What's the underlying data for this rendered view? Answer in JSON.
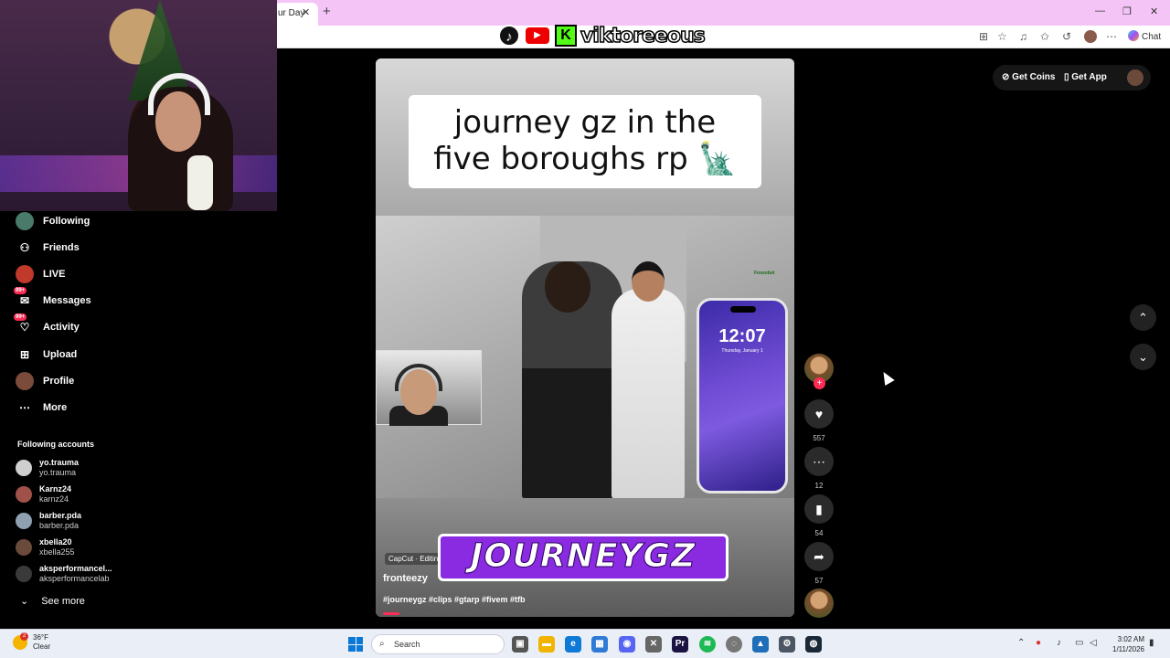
{
  "browser": {
    "tab_title": "ur Day",
    "tab_close": "✕",
    "new_tab": "+",
    "chat_label": "Chat",
    "minimize": "—",
    "maximize": "❐",
    "close": "✕"
  },
  "overlay": {
    "tiktok_glyph": "♪",
    "youtube_glyph": "▶",
    "kick_glyph": "K",
    "streamer_name": "viktoreeous"
  },
  "sidebar": {
    "items": [
      {
        "label": "Following",
        "icon": "following-avatar"
      },
      {
        "label": "Friends",
        "icon": "friends-icon"
      },
      {
        "label": "LIVE",
        "icon": "live-avatar"
      },
      {
        "label": "Messages",
        "icon": "messages-icon",
        "badge": "99+"
      },
      {
        "label": "Activity",
        "icon": "activity-icon",
        "badge": "99+"
      },
      {
        "label": "Upload",
        "icon": "upload-icon"
      },
      {
        "label": "Profile",
        "icon": "profile-avatar"
      },
      {
        "label": "More",
        "icon": "more-icon"
      }
    ],
    "following_title": "Following accounts",
    "accounts": [
      {
        "name": "yo.trauma",
        "handle": "yo.trauma"
      },
      {
        "name": "Karnz24",
        "handle": "karnz24"
      },
      {
        "name": "barber.pda",
        "handle": "barber.pda"
      },
      {
        "name": "xbella20",
        "handle": "xbella255"
      },
      {
        "name": "aksperformancel...",
        "handle": "aksperformancelab"
      }
    ],
    "see_more": "See more"
  },
  "video": {
    "title_line1": "journey gz in the",
    "title_line2": "five boroughs rp 🗽",
    "phone_time": "12:07",
    "phone_date": "Thursday, January 1",
    "corner_text": "Fossobot",
    "capcut": "CapCut · Editing made easy",
    "banner": "JOURNEYGZ",
    "author": "fronteezy",
    "tags": "#journeygz #clips #gtarp #fivem #tfb",
    "progress": 0.04
  },
  "actions": {
    "follow_plus": "+",
    "like_count": "557",
    "comment_count": "12",
    "save_count": "54",
    "share_count": "57"
  },
  "header": {
    "coins": "Get Coins",
    "app": "Get App"
  },
  "nav": {
    "up": "⌃",
    "down": "⌄"
  },
  "taskbar": {
    "temp": "36°F",
    "condition": "Clear",
    "weather_badge": "2",
    "search": "Search",
    "time": "3:02 AM",
    "date": "1/11/2026"
  },
  "colors": {
    "accent": "#fe2c55",
    "tab_bar": "#f4c4f7",
    "banner": "#8a2be2"
  }
}
